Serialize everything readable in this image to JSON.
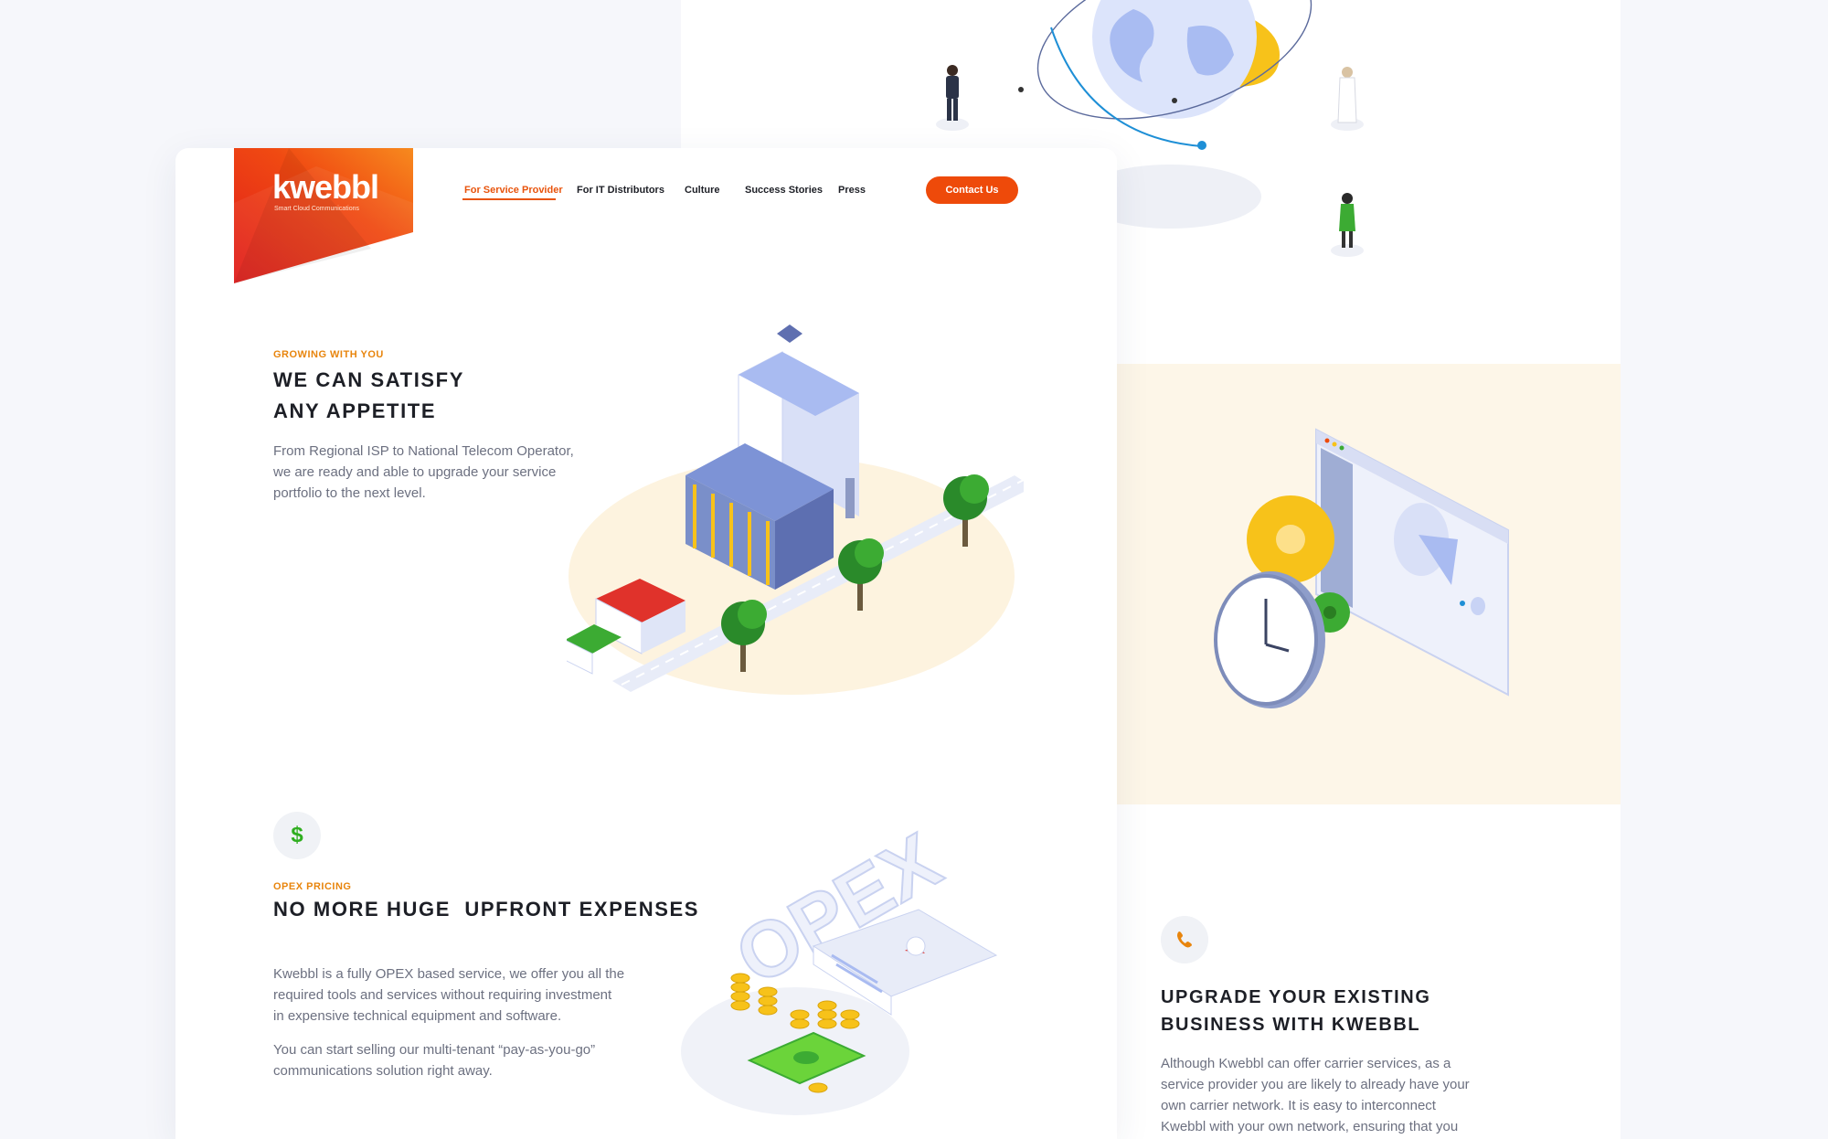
{
  "brand": {
    "name": "kwebbl",
    "tagline": "Smart Cloud Communications"
  },
  "nav": {
    "items": [
      {
        "label": "For Service Provider",
        "active": true
      },
      {
        "label": "For IT Distributors"
      },
      {
        "label": "Culture"
      },
      {
        "label": "Success Stories"
      },
      {
        "label": "Press"
      }
    ],
    "cta": "Contact Us"
  },
  "hero": {
    "eyebrow": "GROWING WITH YOU",
    "title_line1": "WE CAN SATISFY",
    "title_line2": "ANY APPETITE",
    "body_line1": "From Regional ISP to National Telecom Operator,",
    "body_line2": "we are ready and able to upgrade your service",
    "body_line3": "portfolio to the next level."
  },
  "opex": {
    "icon_symbol": "$",
    "eyebrow": "OPEX PRICING",
    "title": "NO MORE HUGE  UPFRONT EXPENSES",
    "body1_line1": "Kwebbl is a fully OPEX based service, we offer you all the",
    "body1_line2": "required tools and services without requiring investment",
    "body1_line3": "in expensive technical equipment and software.",
    "body2_line1": "You can start selling our multi-tenant “pay-as-you-go”",
    "body2_line2": "communications solution right away.",
    "illustration_word": "OPEX"
  },
  "upgrade": {
    "title_line1": "UPGRADE YOUR EXISTING",
    "title_line2": "BUSINESS WITH KWEBBL",
    "body_line1": "Although Kwebbl can offer carrier services, as a",
    "body_line2": "service provider you are likely to already have your",
    "body_line3": "own carrier network. It is easy to interconnect",
    "body_line4": "Kwebbl with your own network, ensuring that you"
  },
  "colors": {
    "brand_orange": "#ee4a0a",
    "accent_orange": "#e8850d",
    "cream": "#fdf6e8",
    "green": "#2fae1f"
  },
  "icons": [
    "dollar-icon",
    "phone-icon"
  ]
}
